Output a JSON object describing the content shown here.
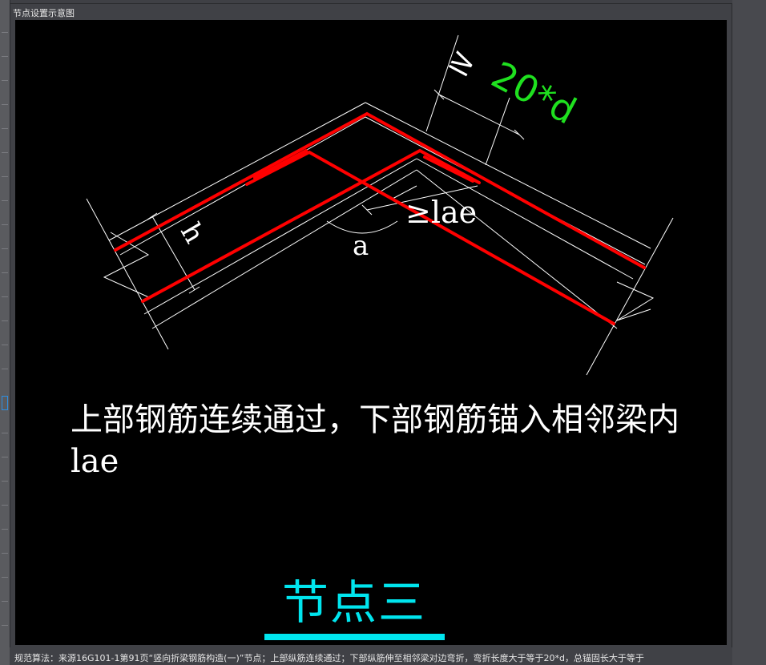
{
  "window": {
    "title": "节点设置示意图"
  },
  "diagram": {
    "dim_top_symbol": "≥",
    "dim_top_value": "20*d",
    "dim_mid": "≥lae",
    "label_h": "h",
    "label_a": "a",
    "note": "上部钢筋连续通过，下部钢筋锚入相邻梁内lae",
    "node_title": "节点三"
  },
  "colors": {
    "rebar": "#ff0000",
    "outline": "#ffffff",
    "accent_green": "#1fe01f",
    "title_cyan": "#00e5ee",
    "canvas_bg": "#000000"
  },
  "status": {
    "text": "规范算法：来源16G101-1第91页“竖向折梁钢筋构造(一)”节点；上部纵筋连续通过；下部纵筋伸至相邻梁对边弯折，弯折长度大于等于20*d，总锚固长大于等于"
  }
}
